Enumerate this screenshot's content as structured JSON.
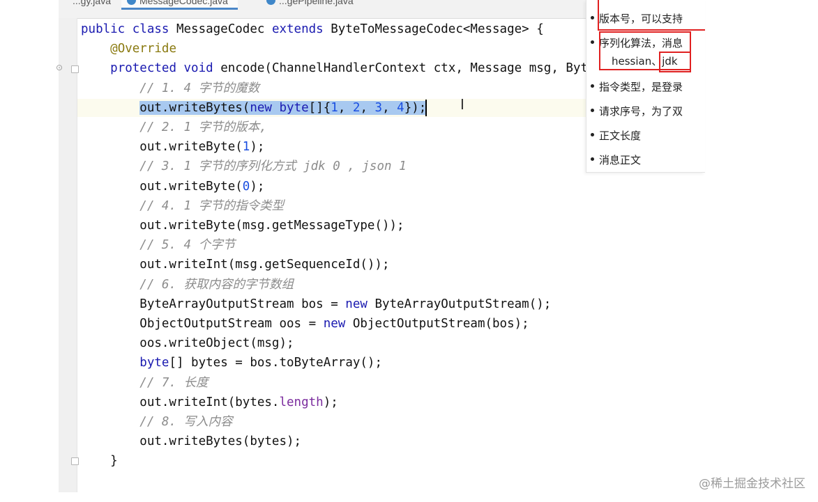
{
  "tabs": [
    "...gy.java",
    "MessageCodec.java",
    "...gePipeline.java"
  ],
  "code_lines": [
    [
      {
        "t": "public class ",
        "c": "kw"
      },
      {
        "t": "MessageCodec ",
        "c": ""
      },
      {
        "t": "extends ",
        "c": "kw"
      },
      {
        "t": "ByteToMessageCodec<Message> {",
        "c": ""
      }
    ],
    [
      {
        "t": "    ",
        "c": ""
      },
      {
        "t": "@Override",
        "c": "ann"
      }
    ],
    [
      {
        "t": "    ",
        "c": ""
      },
      {
        "t": "protected void ",
        "c": "kw"
      },
      {
        "t": "encode(ChannelHandlerContext ctx, Message msg, Byt",
        "c": ""
      }
    ],
    [
      {
        "t": "        // 1. 4 字节的魔数",
        "c": "cmt"
      }
    ],
    [
      {
        "t": "        ",
        "c": ""
      },
      {
        "t": "out.writeBytes(",
        "c": "sel"
      },
      {
        "t": "new ",
        "c": "kw sel"
      },
      {
        "t": "byte",
        "c": "kw sel"
      },
      {
        "t": "[]{",
        "c": "sel"
      },
      {
        "t": "1",
        "c": "num sel"
      },
      {
        "t": ", ",
        "c": "sel"
      },
      {
        "t": "2",
        "c": "num sel"
      },
      {
        "t": ", ",
        "c": "sel"
      },
      {
        "t": "3",
        "c": "num sel"
      },
      {
        "t": ", ",
        "c": "sel"
      },
      {
        "t": "4",
        "c": "num sel"
      },
      {
        "t": "});",
        "c": "sel"
      }
    ],
    [
      {
        "t": "        // 2. 1 字节的版本,",
        "c": "cmt"
      }
    ],
    [
      {
        "t": "        out.writeByte(",
        "c": ""
      },
      {
        "t": "1",
        "c": "num"
      },
      {
        "t": ");",
        "c": ""
      }
    ],
    [
      {
        "t": "        // 3. 1 字节的序列化方式 jdk 0 , json 1",
        "c": "cmt"
      }
    ],
    [
      {
        "t": "        out.writeByte(",
        "c": ""
      },
      {
        "t": "0",
        "c": "num"
      },
      {
        "t": ");",
        "c": ""
      }
    ],
    [
      {
        "t": "        // 4. 1 字节的指令类型",
        "c": "cmt"
      }
    ],
    [
      {
        "t": "        out.writeByte(msg.getMessageType());",
        "c": ""
      }
    ],
    [
      {
        "t": "        // 5. 4 个字节",
        "c": "cmt"
      }
    ],
    [
      {
        "t": "        out.writeInt(msg.getSequenceId());",
        "c": ""
      }
    ],
    [
      {
        "t": "        // 6. 获取内容的字节数组",
        "c": "cmt"
      }
    ],
    [
      {
        "t": "        ByteArrayOutputStream bos = ",
        "c": ""
      },
      {
        "t": "new ",
        "c": "kw"
      },
      {
        "t": "ByteArrayOutputStream();",
        "c": ""
      }
    ],
    [
      {
        "t": "        ObjectOutputStream oos = ",
        "c": ""
      },
      {
        "t": "new ",
        "c": "kw"
      },
      {
        "t": "ObjectOutputStream(bos);",
        "c": ""
      }
    ],
    [
      {
        "t": "        oos.writeObject(msg);",
        "c": ""
      }
    ],
    [
      {
        "t": "        ",
        "c": ""
      },
      {
        "t": "byte",
        "c": "kw"
      },
      {
        "t": "[] bytes = bos.toByteArray();",
        "c": ""
      }
    ],
    [
      {
        "t": "        // 7. 长度",
        "c": "cmt"
      }
    ],
    [
      {
        "t": "        out.writeInt(bytes.",
        "c": ""
      },
      {
        "t": "length",
        "c": "fld"
      },
      {
        "t": ");",
        "c": ""
      }
    ],
    [
      {
        "t": "        // 8. 写入内容",
        "c": "cmt"
      }
    ],
    [
      {
        "t": "        out.writeBytes(bytes);",
        "c": ""
      }
    ],
    [
      {
        "t": "    }",
        "c": ""
      }
    ]
  ],
  "doc_panel": {
    "version_item": "版本号，可以支持",
    "serialization_item": "序列化算法，消息",
    "serialization_options_prefix": "hessian、",
    "serialization_highlight": "jdk",
    "command_type_item": "指令类型，是登录",
    "sequence_item": "请求序号，为了双",
    "length_item": "正文长度",
    "body_item": "消息正文"
  },
  "watermark": "@稀土掘金技术社区",
  "colors": {
    "keyword": "#1a1ab0",
    "annotation": "#8a7a10",
    "field": "#7b2c9e",
    "number": "#1a4ee0",
    "comment": "#8c8c8c",
    "selection": "#a8c9f0",
    "highlight_box": "#e02020"
  }
}
